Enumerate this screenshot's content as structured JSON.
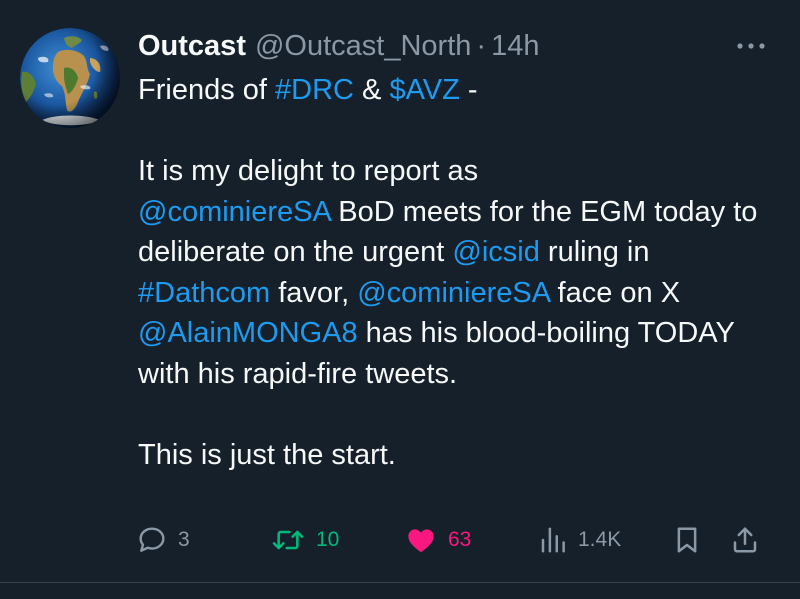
{
  "author": {
    "name": "Outcast",
    "handle": "@Outcast_North",
    "separator": "·",
    "time": "14h"
  },
  "tweet": {
    "line1": [
      {
        "text": "Friends of ",
        "type": "text"
      },
      {
        "text": "#DRC",
        "type": "link"
      },
      {
        "text": " & ",
        "type": "text"
      },
      {
        "text": "$AVZ",
        "type": "link"
      },
      {
        "text": " -",
        "type": "text"
      }
    ],
    "p2_seg1": "It is my delight to report as",
    "p2_mention1": "@cominiereSA",
    "p2_seg2": " BoD meets for the EGM today to deliberate on the urgent ",
    "p2_mention2": "@icsid",
    "p2_seg3": " ruling in ",
    "p2_hashtag": "#Dathcom",
    "p2_seg4": " favor, ",
    "p2_mention3": "@cominiereSA",
    "p2_seg5": " face on X ",
    "p2_mention4": "@AlainMONGA8",
    "p2_seg6": " has his blood-boiling TODAY with his rapid-fire tweets.",
    "p3": "This is just the start."
  },
  "actions": {
    "replies": "3",
    "reposts": "10",
    "likes": "63",
    "views": "1.4K"
  },
  "colors": {
    "background": "#15202b",
    "text": "#f7f9f9",
    "secondary": "#8b98a5",
    "link": "#1d9bf0",
    "repost": "#00ba7c",
    "like": "#f91880"
  },
  "icons": {
    "more": "more-horizontal-icon",
    "reply": "reply-bubble-icon",
    "repost": "repost-arrows-icon",
    "like": "heart-filled-icon",
    "views": "views-bars-icon",
    "bookmark": "bookmark-icon",
    "share": "share-upload-icon",
    "avatar": "earth-globe-avatar"
  }
}
